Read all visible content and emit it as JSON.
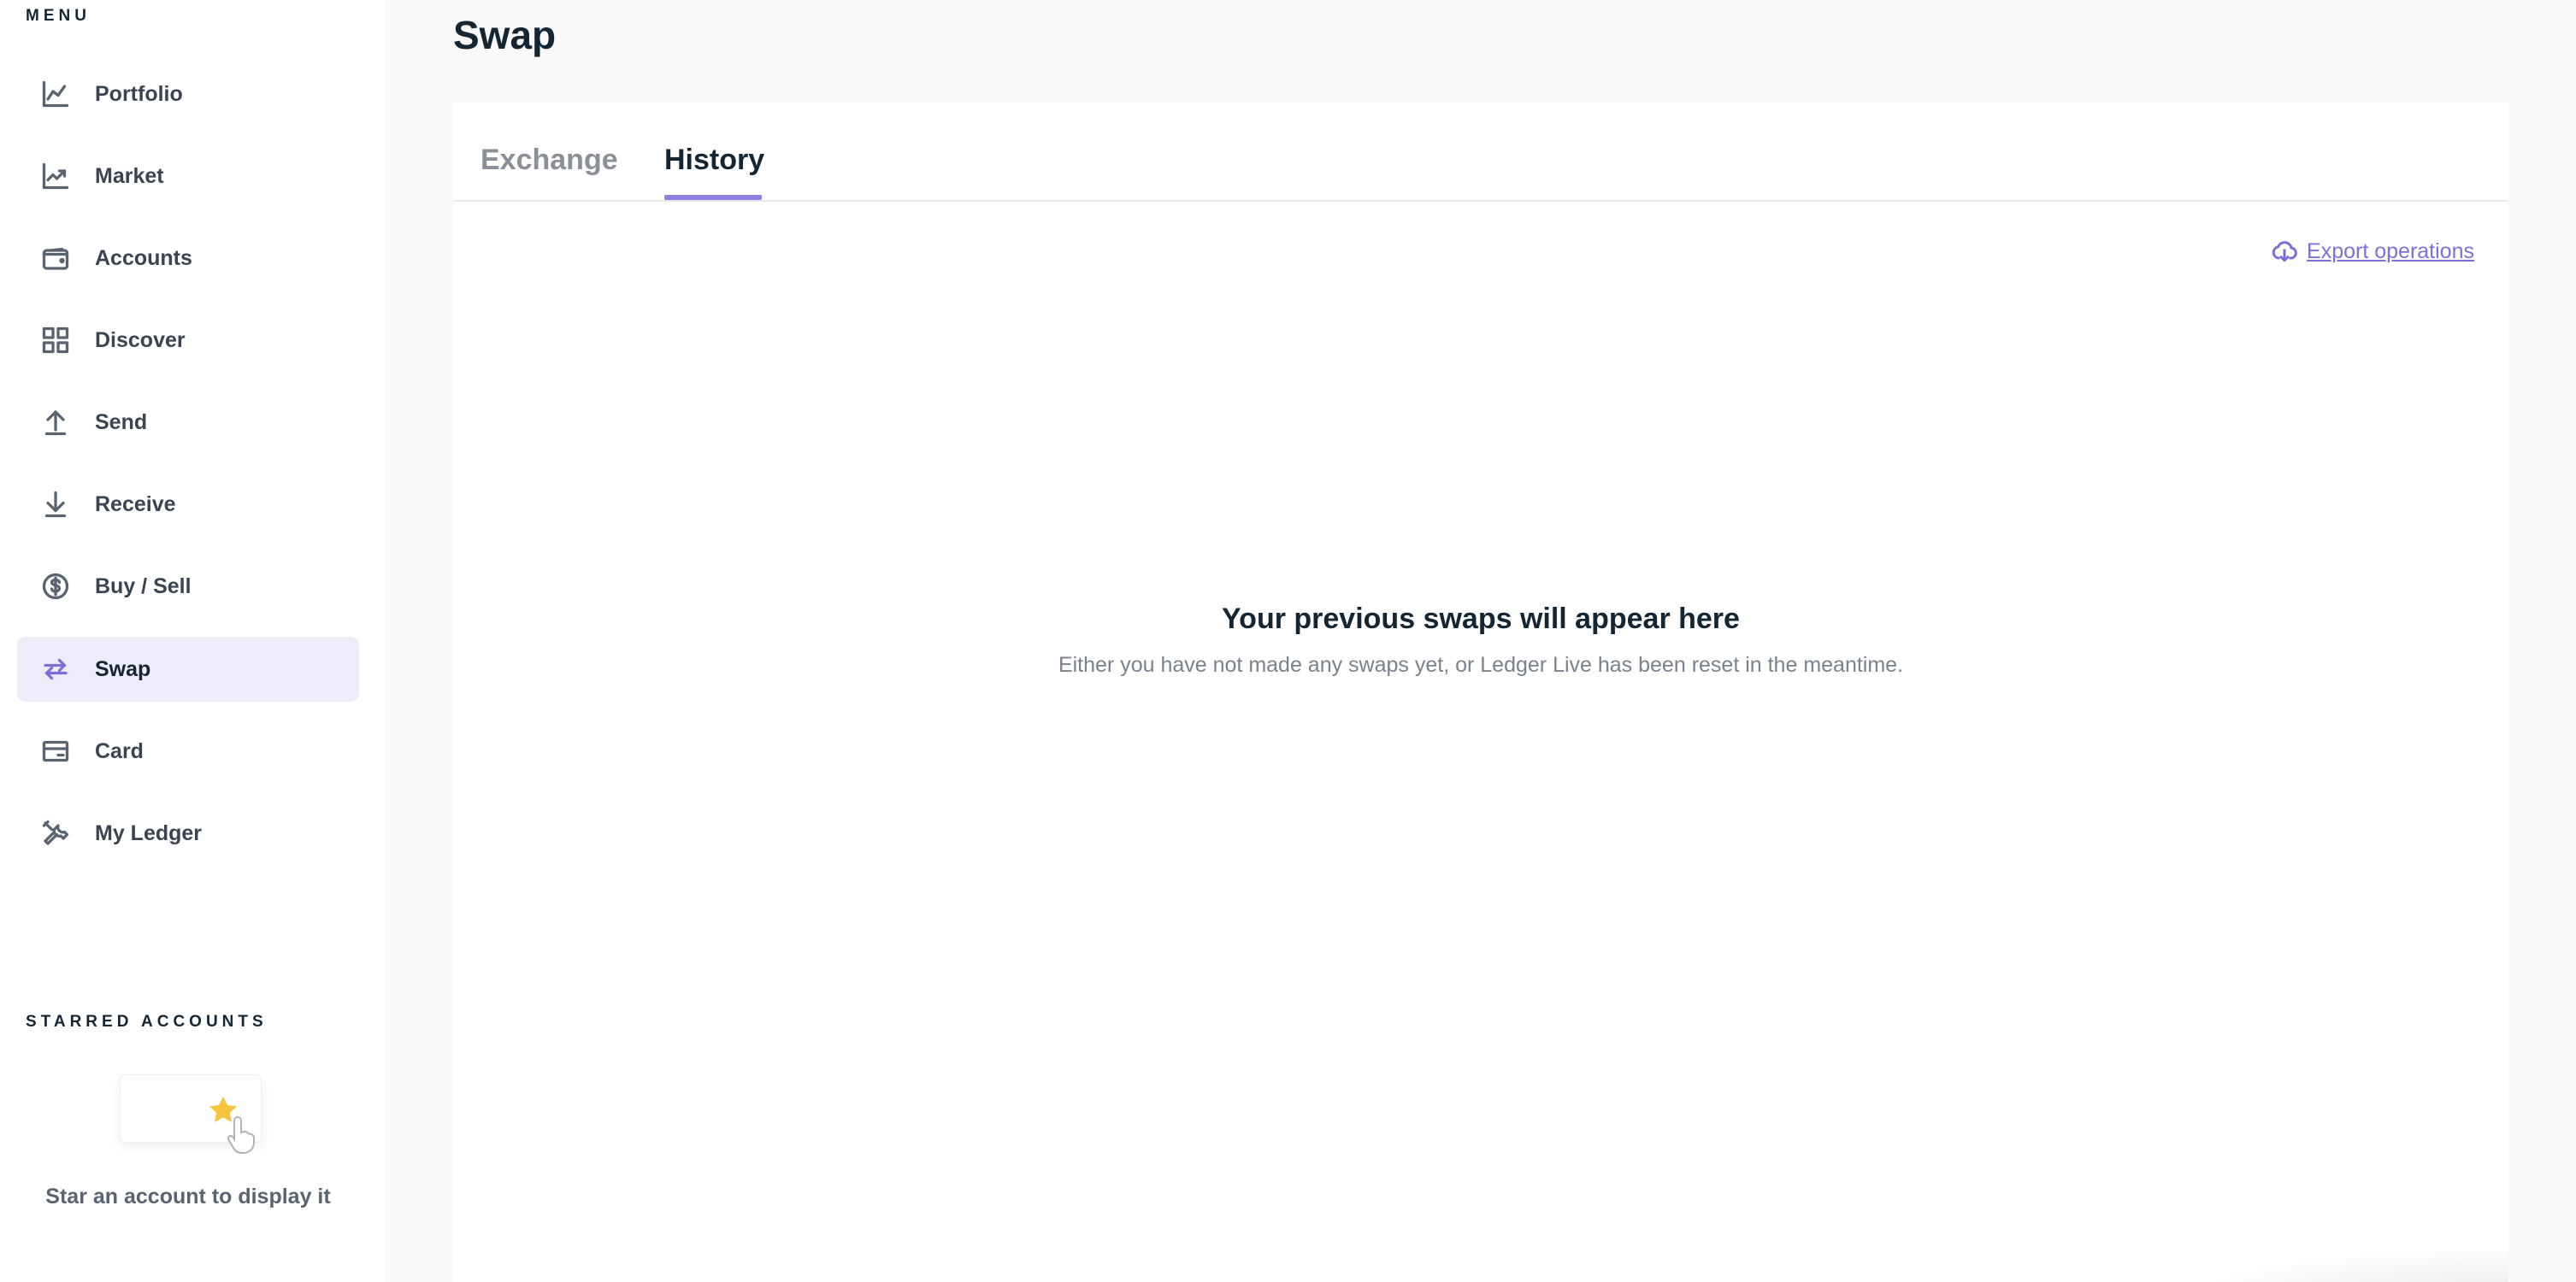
{
  "sidebar": {
    "menu_title": "MENU",
    "items": [
      {
        "label": "Portfolio",
        "icon": "chart-line-icon"
      },
      {
        "label": "Market",
        "icon": "trend-up-icon"
      },
      {
        "label": "Accounts",
        "icon": "wallet-icon"
      },
      {
        "label": "Discover",
        "icon": "grid-icon"
      },
      {
        "label": "Send",
        "icon": "arrow-up-icon"
      },
      {
        "label": "Receive",
        "icon": "arrow-down-icon"
      },
      {
        "label": "Buy / Sell",
        "icon": "dollar-circle-icon"
      },
      {
        "label": "Swap",
        "icon": "swap-icon",
        "active": true
      },
      {
        "label": "Card",
        "icon": "card-icon"
      },
      {
        "label": "My Ledger",
        "icon": "tools-icon"
      }
    ],
    "starred_title": "STARRED ACCOUNTS",
    "starred_caption": "Star an account to display it"
  },
  "main": {
    "title": "Swap",
    "tabs": [
      {
        "label": "Exchange",
        "active": false
      },
      {
        "label": "History",
        "active": true
      }
    ],
    "export_label": "Export operations",
    "empty_title": "Your previous swaps will appear here",
    "empty_description": "Either you have not made any swaps yet, or Ledger Live has been reset in the meantime."
  },
  "colors": {
    "accent": "#7e6ed9",
    "active_bg": "#efecf9",
    "star": "#f5c542"
  }
}
